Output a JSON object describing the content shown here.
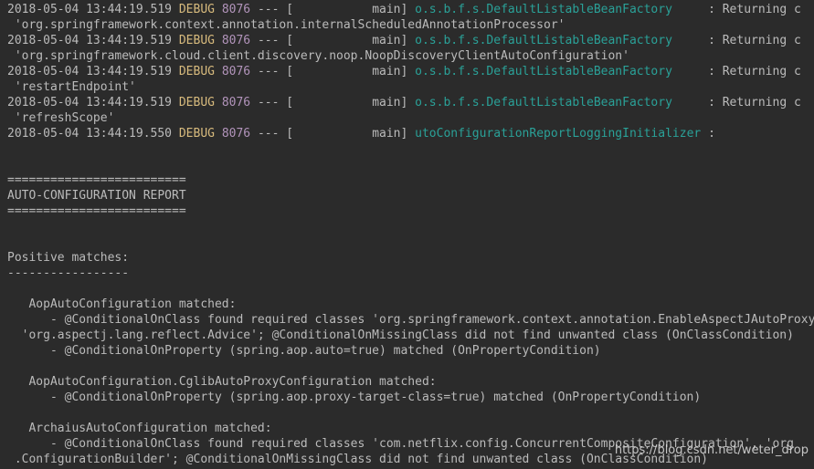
{
  "log_entries": [
    {
      "date": "2018-05-04 13:44:19.519",
      "level": "DEBUG",
      "pid": "8076",
      "sep": "--- [",
      "thread": "main]",
      "logger": "o.s.b.f.s.DefaultListableBeanFactory",
      "msg": ": Returning c"
    },
    {
      "cont": "'org.springframework.context.annotation.internalScheduledAnnotationProcessor'"
    },
    {
      "date": "2018-05-04 13:44:19.519",
      "level": "DEBUG",
      "pid": "8076",
      "sep": "--- [",
      "thread": "main]",
      "logger": "o.s.b.f.s.DefaultListableBeanFactory",
      "msg": ": Returning c"
    },
    {
      "cont": "'org.springframework.cloud.client.discovery.noop.NoopDiscoveryClientAutoConfiguration'"
    },
    {
      "date": "2018-05-04 13:44:19.519",
      "level": "DEBUG",
      "pid": "8076",
      "sep": "--- [",
      "thread": "main]",
      "logger": "o.s.b.f.s.DefaultListableBeanFactory",
      "msg": ": Returning c"
    },
    {
      "cont": "'restartEndpoint'"
    },
    {
      "date": "2018-05-04 13:44:19.519",
      "level": "DEBUG",
      "pid": "8076",
      "sep": "--- [",
      "thread": "main]",
      "logger": "o.s.b.f.s.DefaultListableBeanFactory",
      "msg": ": Returning c"
    },
    {
      "cont": "'refreshScope'"
    },
    {
      "date": "2018-05-04 13:44:19.550",
      "level": "DEBUG",
      "pid": "8076",
      "sep": "--- [",
      "thread": "main]",
      "logger": "utoConfigurationReportLoggingInitializer",
      "msg": ":"
    }
  ],
  "report": {
    "rule_top": "=========================",
    "title": "AUTO-CONFIGURATION REPORT",
    "rule_bottom": "=========================",
    "positive_heading": "Positive matches:",
    "positive_rule": "-----------------",
    "lines": [
      "   AopAutoConfiguration matched:",
      "      - @ConditionalOnClass found required classes 'org.springframework.context.annotation.EnableAspectJAutoProxy',",
      "  'org.aspectj.lang.reflect.Advice'; @ConditionalOnMissingClass did not find unwanted class (OnClassCondition)",
      "      - @ConditionalOnProperty (spring.aop.auto=true) matched (OnPropertyCondition)",
      "",
      "   AopAutoConfiguration.CglibAutoProxyConfiguration matched:",
      "      - @ConditionalOnProperty (spring.aop.proxy-target-class=true) matched (OnPropertyCondition)",
      "",
      "   ArchaiusAutoConfiguration matched:",
      "      - @ConditionalOnClass found required classes 'com.netflix.config.ConcurrentCompositeConfiguration', 'org",
      " .ConfigurationBuilder'; @ConditionalOnMissingClass did not find unwanted class (OnClassCondition)"
    ]
  },
  "watermark": "https://blog.csdn.net/weter_drop"
}
